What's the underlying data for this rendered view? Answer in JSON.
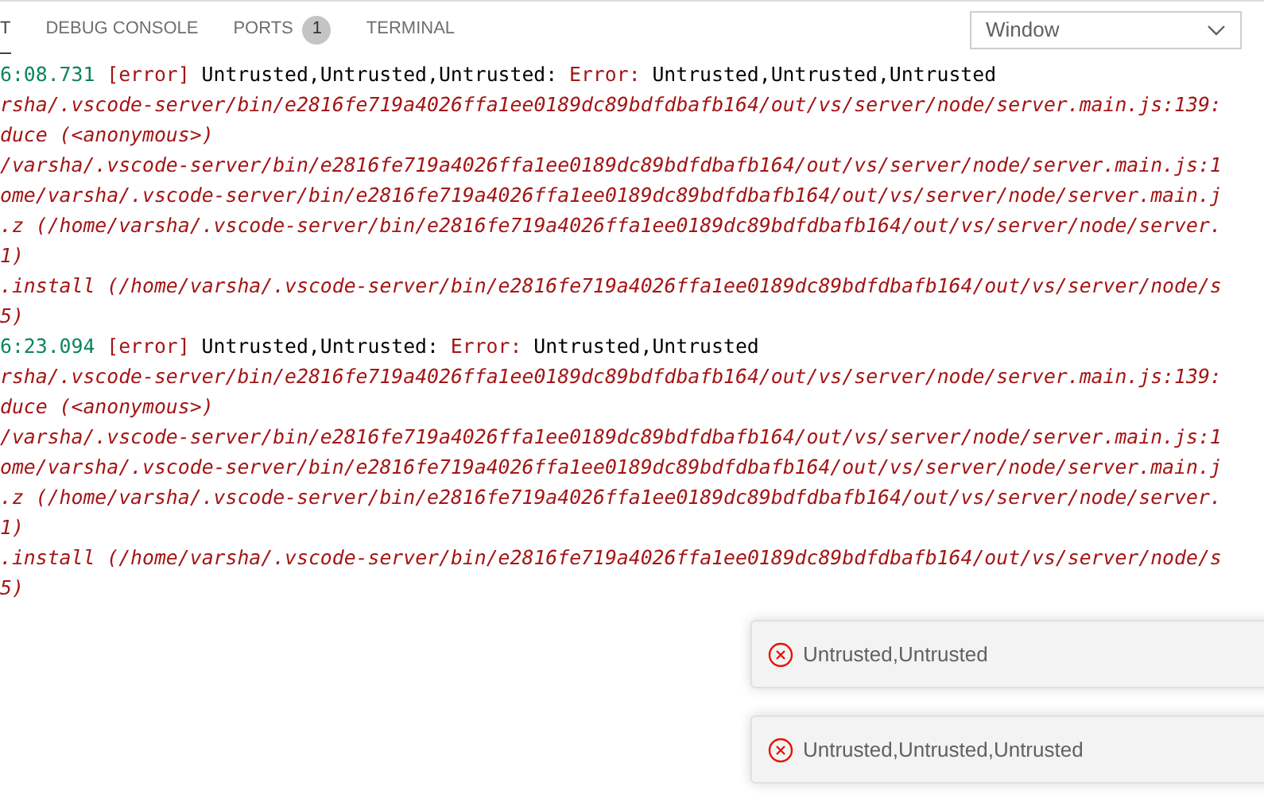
{
  "tabs": [
    {
      "label": "T",
      "selected": true
    },
    {
      "label": "DEBUG CONSOLE",
      "selected": false
    },
    {
      "label": "PORTS",
      "selected": false,
      "badge": "1"
    },
    {
      "label": "TERMINAL",
      "selected": false
    }
  ],
  "dropdown": {
    "value": "Window"
  },
  "log": [
    {
      "header": {
        "time": "6:08.731",
        "level": "[error]",
        "source": "Untrusted,Untrusted,Untrusted:",
        "label": "Error:",
        "message": "Untrusted,Untrusted,Untrusted"
      },
      "stack": [
        "rsha/.vscode-server/bin/e2816fe719a4026ffa1ee0189dc89bdfdbafb164/out/vs/server/node/server.main.js:139:",
        "duce (<anonymous>)",
        "/varsha/.vscode-server/bin/e2816fe719a4026ffa1ee0189dc89bdfdbafb164/out/vs/server/node/server.main.js:1",
        "ome/varsha/.vscode-server/bin/e2816fe719a4026ffa1ee0189dc89bdfdbafb164/out/vs/server/node/server.main.j",
        ".z (/home/varsha/.vscode-server/bin/e2816fe719a4026ffa1ee0189dc89bdfdbafb164/out/vs/server/node/server.",
        "1)",
        ".install (/home/varsha/.vscode-server/bin/e2816fe719a4026ffa1ee0189dc89bdfdbafb164/out/vs/server/node/s",
        "5)"
      ]
    },
    {
      "header": {
        "time": "6:23.094",
        "level": "[error]",
        "source": "Untrusted,Untrusted:",
        "label": "Error:",
        "message": "Untrusted,Untrusted"
      },
      "stack": [
        "rsha/.vscode-server/bin/e2816fe719a4026ffa1ee0189dc89bdfdbafb164/out/vs/server/node/server.main.js:139:",
        "duce (<anonymous>)",
        "/varsha/.vscode-server/bin/e2816fe719a4026ffa1ee0189dc89bdfdbafb164/out/vs/server/node/server.main.js:1",
        "ome/varsha/.vscode-server/bin/e2816fe719a4026ffa1ee0189dc89bdfdbafb164/out/vs/server/node/server.main.j",
        ".z (/home/varsha/.vscode-server/bin/e2816fe719a4026ffa1ee0189dc89bdfdbafb164/out/vs/server/node/server.",
        "1)",
        ".install (/home/varsha/.vscode-server/bin/e2816fe719a4026ffa1ee0189dc89bdfdbafb164/out/vs/server/node/s",
        "5)"
      ]
    }
  ],
  "notifications": [
    {
      "kind": "error",
      "message": "Untrusted,Untrusted"
    },
    {
      "kind": "error",
      "message": "Untrusted,Untrusted,Untrusted"
    }
  ]
}
